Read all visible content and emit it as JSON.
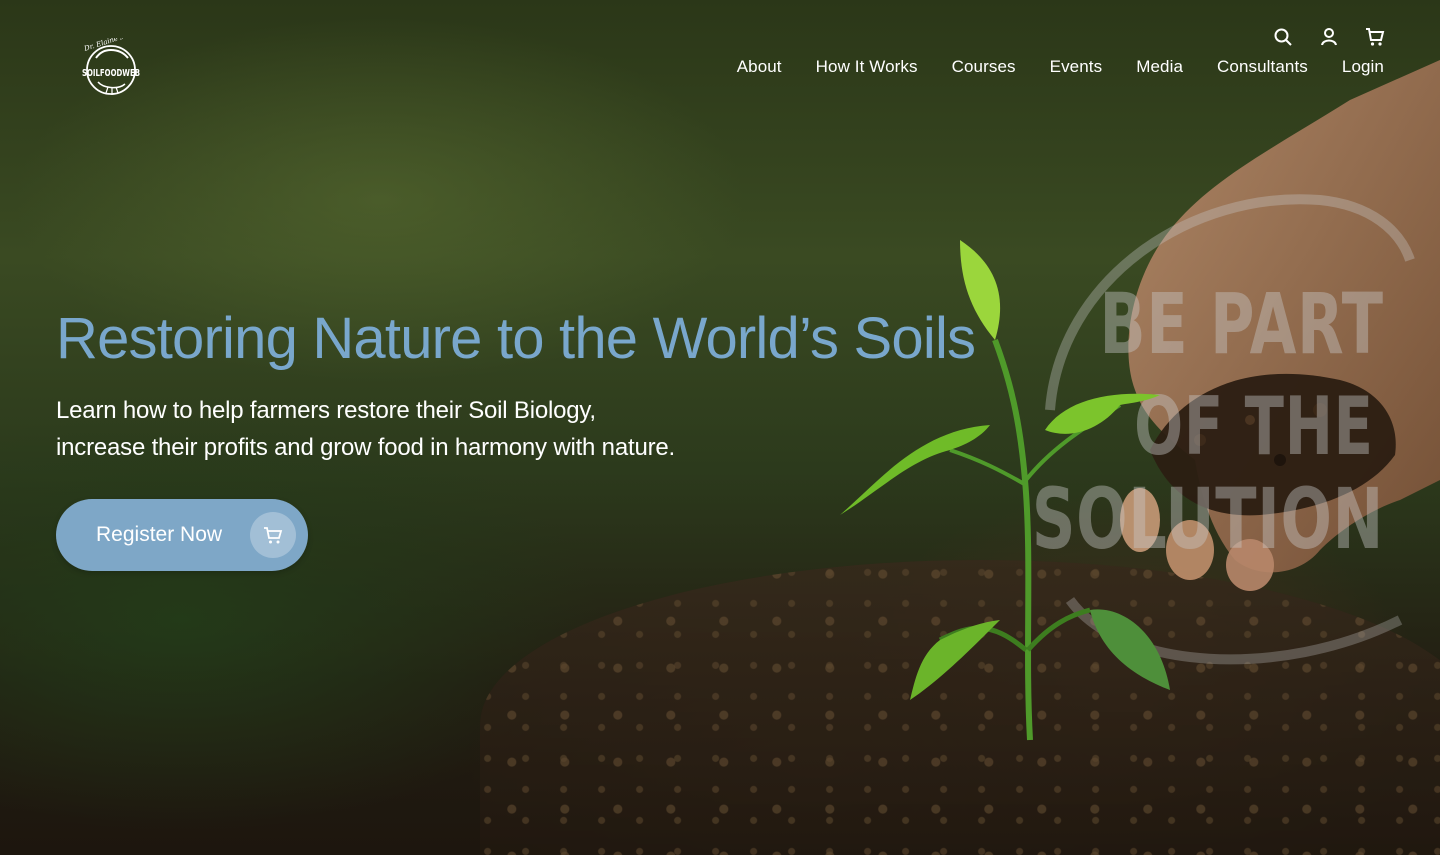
{
  "brand": {
    "logo_top_text": "Dr. Elaine's",
    "logo_main_text": "SOILFOODWEB"
  },
  "header": {
    "utility_icons": [
      "search-icon",
      "user-icon",
      "cart-icon"
    ],
    "nav": [
      "About",
      "How It Works",
      "Courses",
      "Events",
      "Media",
      "Consultants",
      "Login"
    ]
  },
  "hero": {
    "headline": "Restoring Nature to the World’s Soils",
    "subline_1": "Learn how to help farmers restore their Soil Biology,",
    "subline_2": "increase their profits and grow food in harmony with nature.",
    "cta_label": "Register Now",
    "cta_icon": "cart-icon",
    "stamp_lines": [
      "BE PART",
      "OF THE",
      "SOLUTION"
    ]
  },
  "colors": {
    "headline": "#79a7cc",
    "cta_background": "#7ea7c7",
    "text": "#ffffff"
  }
}
